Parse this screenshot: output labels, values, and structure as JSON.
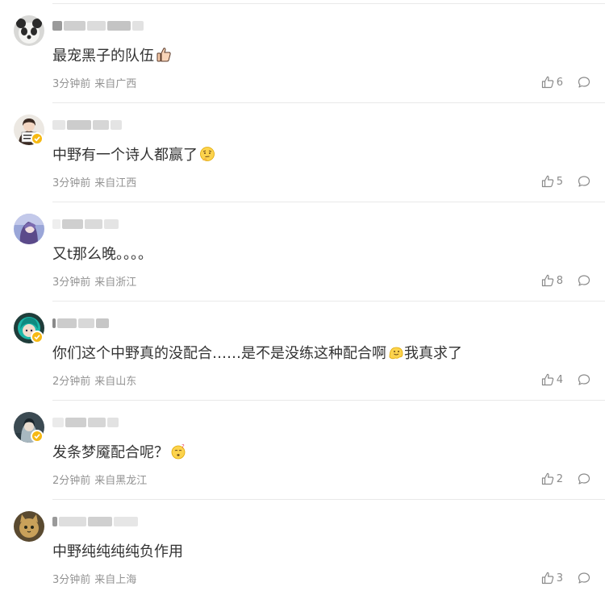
{
  "comments": [
    {
      "text": "最宠黑子的队伍",
      "emoji": "thumbs-up-emoji",
      "time": "3分钟前",
      "location": "来自广西",
      "likes": "6",
      "verified": false,
      "avatar": "panda-avatar"
    },
    {
      "text": "中野有一个诗人都赢了",
      "emoji": "thinking-face-emoji",
      "time": "3分钟前",
      "location": "来自江西",
      "likes": "5",
      "verified": true,
      "avatar": "girl-sign-avatar"
    },
    {
      "text": "又t那么晚。。。。",
      "emoji": "",
      "time": "3分钟前",
      "location": "来自浙江",
      "likes": "8",
      "verified": false,
      "avatar": "purple-hair-avatar"
    },
    {
      "text": "你们这个中野真的没配合……是不是没练这种配合啊",
      "text_after": "我真求了",
      "emoji": "melting-face-emoji",
      "time": "2分钟前",
      "location": "来自山东",
      "likes": "4",
      "verified": true,
      "avatar": "teal-anime-avatar"
    },
    {
      "text": "发条梦魇配合呢？",
      "emoji": "confused-face-emoji",
      "time": "2分钟前",
      "location": "来自黑龙江",
      "likes": "2",
      "verified": true,
      "avatar": "dark-anime-avatar"
    },
    {
      "text": "中野纯纯纯纯负作用",
      "emoji": "",
      "time": "3分钟前",
      "location": "来自上海",
      "likes": "3",
      "verified": false,
      "avatar": "cat-avatar"
    }
  ],
  "colors": {
    "text": "#333333",
    "meta": "#939393",
    "verified_badge": "#f6b913",
    "divider": "#e9e9e9"
  }
}
